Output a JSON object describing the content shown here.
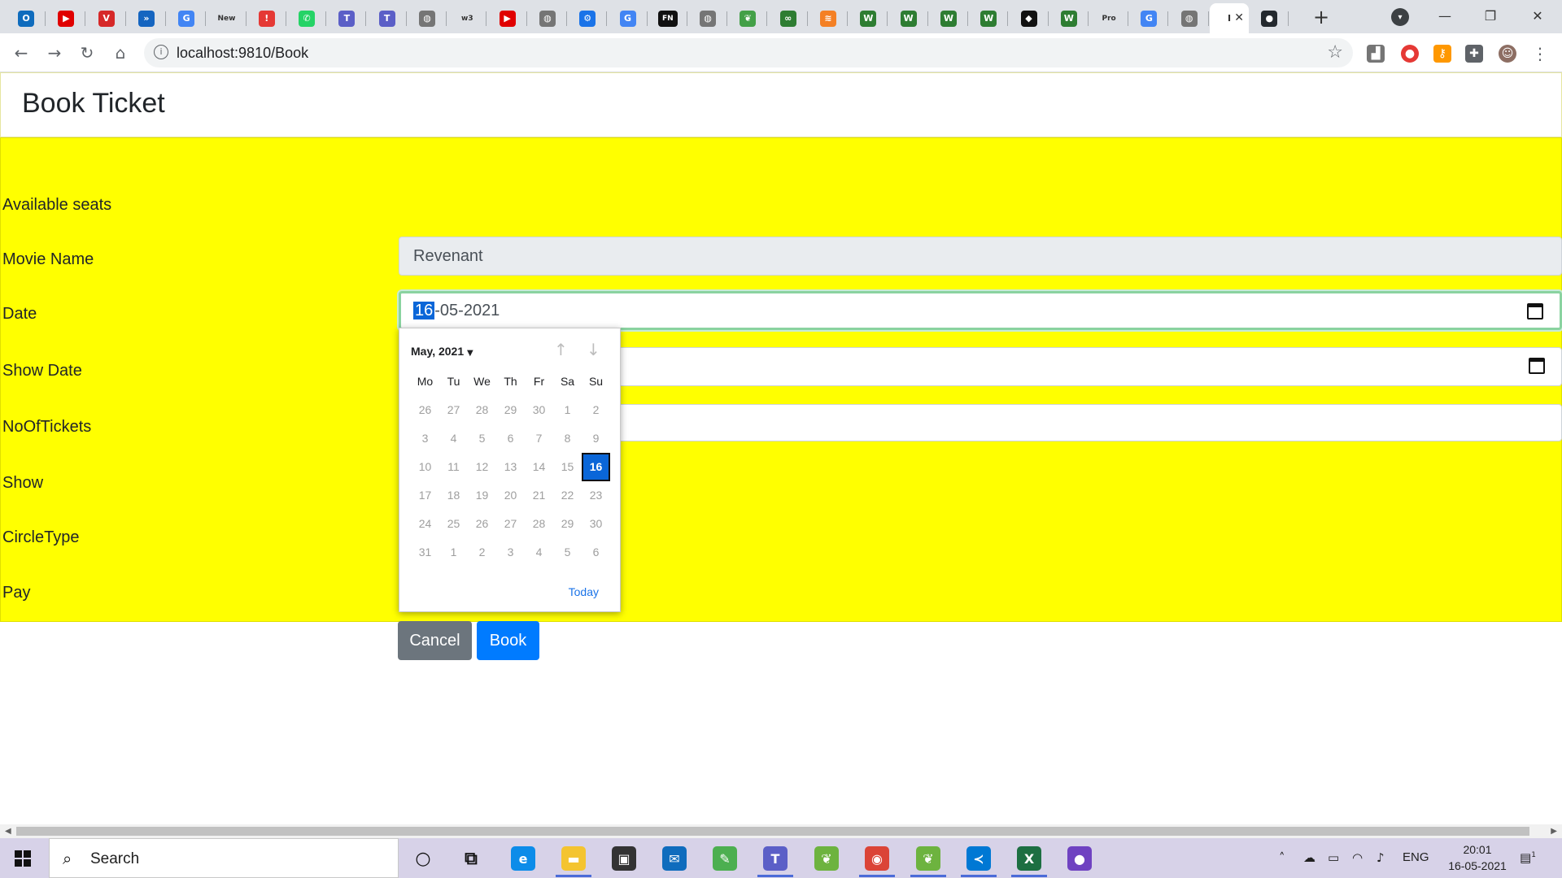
{
  "browser": {
    "tabs": [
      {
        "name": "outlook",
        "glyph": "O",
        "color": "#0f6cbd"
      },
      {
        "name": "youtube",
        "glyph": "▶",
        "color": "#e00000"
      },
      {
        "name": "vivaldi",
        "glyph": "V",
        "color": "#d62828"
      },
      {
        "name": "jira",
        "glyph": "»",
        "color": "#1565c0"
      },
      {
        "name": "google",
        "glyph": "G",
        "color": "#4285f4"
      },
      {
        "name": "new",
        "glyph": "New",
        "color": "#ffffff",
        "text": "New"
      },
      {
        "name": "alert",
        "glyph": "!",
        "color": "#e53935"
      },
      {
        "name": "whatsapp",
        "glyph": "✆",
        "color": "#25d366"
      },
      {
        "name": "teams",
        "glyph": "T",
        "color": "#5b5fc7"
      },
      {
        "name": "teams-2",
        "glyph": "T",
        "color": "#5b5fc7"
      },
      {
        "name": "globe",
        "glyph": "◍",
        "color": "#757575"
      },
      {
        "name": "w3schools",
        "glyph": "w3",
        "color": "#e0e0e0"
      },
      {
        "name": "youtube-2",
        "glyph": "▶",
        "color": "#e00000"
      },
      {
        "name": "globe-2",
        "glyph": "◍",
        "color": "#757575"
      },
      {
        "name": "settings",
        "glyph": "⚙",
        "color": "#1a73e8"
      },
      {
        "name": "google-2",
        "glyph": "G",
        "color": "#4285f4"
      },
      {
        "name": "fn",
        "glyph": "FN",
        "color": "#111111"
      },
      {
        "name": "globe-3",
        "glyph": "◍",
        "color": "#757575"
      },
      {
        "name": "leaf",
        "glyph": "❦",
        "color": "#43a047"
      },
      {
        "name": "infinity",
        "glyph": "∞",
        "color": "#2e7d32"
      },
      {
        "name": "stack",
        "glyph": "≋",
        "color": "#f48024"
      },
      {
        "name": "wikipedia-1",
        "glyph": "W",
        "color": "#2e7d32"
      },
      {
        "name": "wikipedia-2",
        "glyph": "W",
        "color": "#2e7d32"
      },
      {
        "name": "wikipedia-3",
        "glyph": "W",
        "color": "#2e7d32"
      },
      {
        "name": "wikipedia-4",
        "glyph": "W",
        "color": "#2e7d32"
      },
      {
        "name": "notion",
        "glyph": "◆",
        "color": "#111111"
      },
      {
        "name": "wikipedia-5",
        "glyph": "W",
        "color": "#2e7d32"
      },
      {
        "name": "pro",
        "glyph": "Pro",
        "color": "#ffffff"
      },
      {
        "name": "google-3",
        "glyph": "G",
        "color": "#4285f4"
      },
      {
        "name": "globe-4",
        "glyph": "◍",
        "color": "#757575"
      },
      {
        "name": "active-page",
        "glyph": "I",
        "color": "#ffffff",
        "active": true
      },
      {
        "name": "github",
        "glyph": "●",
        "color": "#24292e"
      }
    ],
    "new_tab_icon": "+",
    "url": "localhost:9810/Book"
  },
  "page": {
    "title": "Book Ticket",
    "labels": {
      "available_seats": "Available seats",
      "movie_name": "Movie Name",
      "date": "Date",
      "show_date": "Show Date",
      "no_of_tickets": "NoOfTickets",
      "show": "Show",
      "circle_type": "CircleType",
      "pay": "Pay"
    },
    "fields": {
      "movie_name": "Revenant",
      "date_day": "16",
      "date_rest": "-05-2021"
    },
    "buttons": {
      "cancel": "Cancel",
      "book": "Book"
    },
    "colors": {
      "form_background": "#ffff00",
      "book_button": "#007bff",
      "cancel_button": "#6c757d",
      "selected_date": "#0a66d8"
    }
  },
  "datepicker": {
    "month_label": "May, 2021",
    "weekdays": [
      "Mo",
      "Tu",
      "We",
      "Th",
      "Fr",
      "Sa",
      "Su"
    ],
    "days": [
      "26",
      "27",
      "28",
      "29",
      "30",
      "1",
      "2",
      "3",
      "4",
      "5",
      "6",
      "7",
      "8",
      "9",
      "10",
      "11",
      "12",
      "13",
      "14",
      "15",
      "16",
      "17",
      "18",
      "19",
      "20",
      "21",
      "22",
      "23",
      "24",
      "25",
      "26",
      "27",
      "28",
      "29",
      "30",
      "31",
      "1",
      "2",
      "3",
      "4",
      "5",
      "6"
    ],
    "selected_day": "16",
    "today_label": "Today"
  },
  "taskbar": {
    "search_placeholder": "Search",
    "apps": [
      {
        "name": "cortana",
        "glyph": "○",
        "color": "#111111"
      },
      {
        "name": "task-view",
        "glyph": "⧉",
        "color": "#111111"
      },
      {
        "name": "edge",
        "glyph": "e",
        "color": "#0c8ce9"
      },
      {
        "name": "file-explorer",
        "glyph": "▬",
        "color": "#f4c430",
        "active": true
      },
      {
        "name": "store",
        "glyph": "▣",
        "color": "#333333"
      },
      {
        "name": "mail",
        "glyph": "✉",
        "color": "#0f6cbd"
      },
      {
        "name": "paint",
        "glyph": "✎",
        "color": "#4caf50"
      },
      {
        "name": "teams",
        "glyph": "T",
        "color": "#5b5fc7",
        "active": true
      },
      {
        "name": "spring-tool",
        "glyph": "❦",
        "color": "#6db33f"
      },
      {
        "name": "chrome",
        "glyph": "◉",
        "color": "#db4437",
        "active": true
      },
      {
        "name": "spring-tool-2",
        "glyph": "❦",
        "color": "#6db33f",
        "active": true
      },
      {
        "name": "vscode",
        "glyph": "≺",
        "color": "#0078d4",
        "active": true
      },
      {
        "name": "excel",
        "glyph": "X",
        "color": "#1d6f42",
        "active": true
      },
      {
        "name": "github-desktop",
        "glyph": "●",
        "color": "#6f42c1"
      }
    ],
    "tray": {
      "language": "ENG",
      "time": "20:01",
      "date": "16-05-2021",
      "notification_count": "1"
    }
  }
}
